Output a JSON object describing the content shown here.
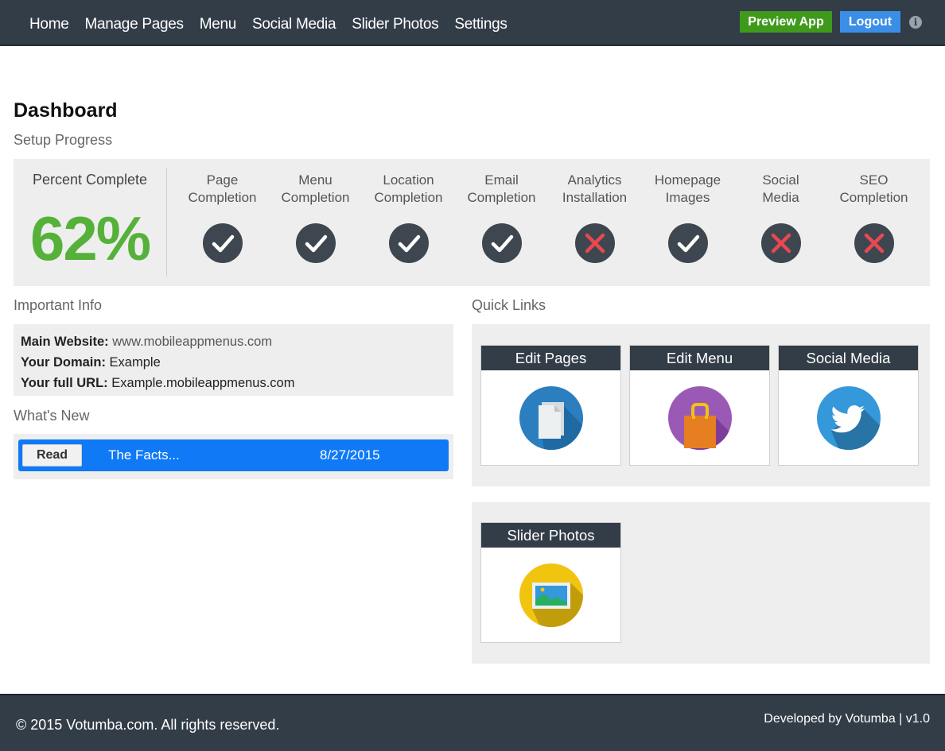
{
  "nav": {
    "items": [
      "Home",
      "Manage Pages",
      "Menu",
      "Social Media",
      "Slider Photos",
      "Settings"
    ],
    "preview_label": "Preview App",
    "logout_label": "Logout",
    "info_glyph": "i"
  },
  "page": {
    "title": "Dashboard",
    "setup_progress_label": "Setup Progress"
  },
  "progress": {
    "percent_label": "Percent Complete",
    "percent_value": "62%",
    "steps": [
      {
        "line1": "Page",
        "line2": "Completion",
        "complete": true
      },
      {
        "line1": "Menu",
        "line2": "Completion",
        "complete": true
      },
      {
        "line1": "Location",
        "line2": "Completion",
        "complete": true
      },
      {
        "line1": "Email",
        "line2": "Completion",
        "complete": true
      },
      {
        "line1": "Analytics",
        "line2": "Installation",
        "complete": false
      },
      {
        "line1": "Homepage",
        "line2": "Images",
        "complete": true
      },
      {
        "line1": "Social",
        "line2": "Media",
        "complete": false
      },
      {
        "line1": "SEO",
        "line2": "Completion",
        "complete": false
      }
    ]
  },
  "important_info": {
    "heading": "Important Info",
    "main_website_label": "Main Website:",
    "main_website_value": "www.mobileappmenus.com",
    "domain_label": "Your Domain:",
    "domain_value": "Example",
    "full_url_label": "Your full URL:",
    "full_url_value": "Example.mobileappmenus.com"
  },
  "whats_new": {
    "heading": "What's New",
    "read_label": "Read",
    "title": "The Facts...",
    "date": "8/27/2015"
  },
  "quick_links": {
    "heading": "Quick Links",
    "tiles": [
      "Edit Pages",
      "Edit Menu",
      "Social Media",
      "Slider Photos"
    ]
  },
  "colors": {
    "navbar": "#333d47",
    "preview_button": "#3f9a1c",
    "logout_button": "#3b8ee7",
    "percent": "#56b13a",
    "status_icon_bg": "#3e464f",
    "cross": "#e8484f",
    "news_bar": "#0f79f6",
    "panel_bg": "#eeeeee",
    "icon_pages": "#2b7fbf",
    "icon_menu": "#9b59b6",
    "icon_bag": "#e67e22",
    "icon_social": "#3498db",
    "icon_photos": "#f1c40f"
  },
  "icons": {
    "complete": "checkmark-icon",
    "incomplete": "cross-icon",
    "edit_pages": "pages-icon",
    "edit_menu": "shopping-bag-icon",
    "social_media": "twitter-bird-icon",
    "slider_photos": "landscape-photo-icon"
  },
  "footer": {
    "copyright": "© 2015 Votumba.com. All rights reserved.",
    "developer": "Developed by Votumba | v1.0"
  }
}
